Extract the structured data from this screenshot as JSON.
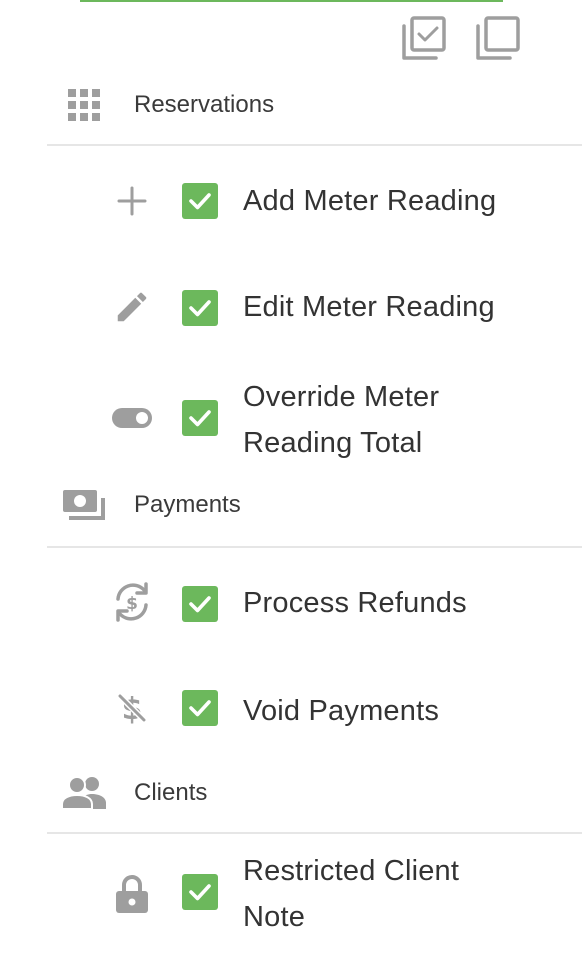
{
  "toolbar": {
    "select_all_icon": "check-all-icon",
    "deselect_all_icon": "uncheck-all-icon"
  },
  "colors": {
    "accent": "#6cb85c",
    "icon_gray": "#9e9e9e",
    "divider": "#e6e6e6",
    "text": "#333333"
  },
  "sections": [
    {
      "label": "Reservations",
      "icon": "grid-icon",
      "items": [
        {
          "label": "Add Meter Reading",
          "icon": "plus-icon",
          "checked": true
        },
        {
          "label": "Edit Meter Reading",
          "icon": "pencil-icon",
          "checked": true
        },
        {
          "label": "Override Meter Reading Total",
          "icon": "toggle-icon",
          "checked": true
        }
      ]
    },
    {
      "label": "Payments",
      "icon": "cash-icon",
      "items": [
        {
          "label": "Process Refunds",
          "icon": "refund-icon",
          "checked": true
        },
        {
          "label": "Void Payments",
          "icon": "money-off-icon",
          "checked": true
        }
      ]
    },
    {
      "label": "Clients",
      "icon": "people-icon",
      "items": [
        {
          "label": "Restricted Client Note",
          "icon": "lock-icon",
          "checked": true
        }
      ]
    }
  ]
}
